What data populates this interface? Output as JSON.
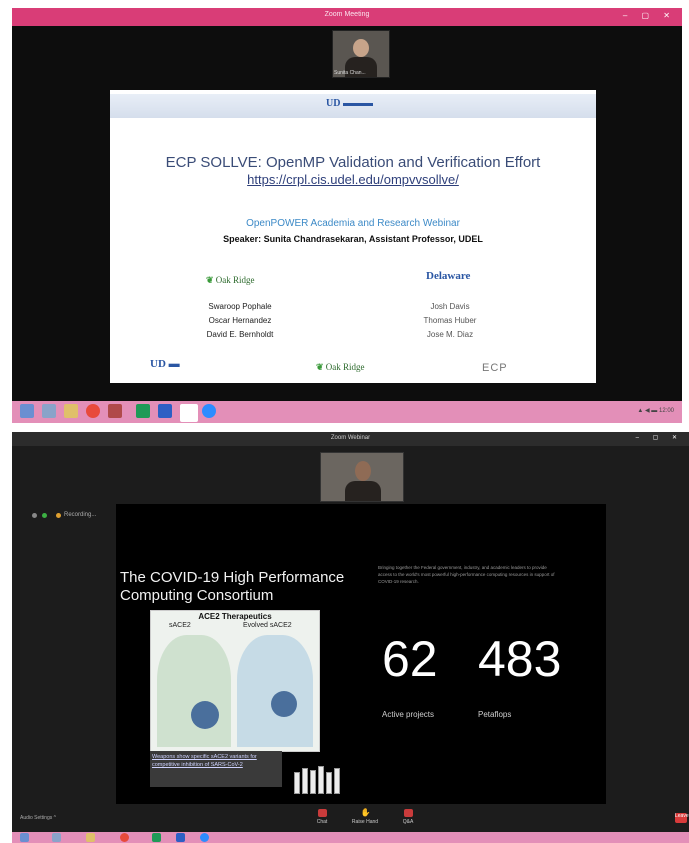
{
  "top_window": {
    "title": "Zoom Meeting",
    "participant_name": "Sunita Chan...",
    "slide": {
      "title": "ECP SOLLVE: OpenMP Validation and Verification Effort",
      "url": "https://crpl.cis.udel.edu/ompvvsollve/",
      "webinar": "OpenPOWER Academia and Research Webinar",
      "speaker": "Speaker: Sunita Chandrasekaran, Assistant Professor, UDEL",
      "ornl_label": "Oak Ridge",
      "ornl_names": [
        "Swaroop Pophale",
        "Oscar Hernandez",
        "David E. Bernholdt"
      ],
      "ud_label": "Delaware",
      "ud_names": [
        "Josh Davis",
        "Thomas Huber",
        "Jose M. Diaz"
      ],
      "ecp_label": "ECP"
    }
  },
  "bottom_window": {
    "title": "Zoom Webinar",
    "recording": "Recording...",
    "slide": {
      "title": "The COVID-19 High Performance Computing Consortium",
      "description": "Bringing together the Federal government, industry, and academic leaders to provide access to the world's most powerful high-performance computing resources in support of COVID-19 research.",
      "figure_title": "ACE2 Therapeutics",
      "figure_left": "sACE2",
      "figure_right": "Evolved sACE2",
      "caption": "Weapons show specific sACE2 variants for competitive inhibition of SARS-CoV-2",
      "stat1_value": "62",
      "stat1_label": "Active projects",
      "stat2_value": "483",
      "stat2_label": "Petaflops"
    },
    "controls": [
      "Chat",
      "Raise Hand",
      "Q&A"
    ],
    "audio_settings": "Audio Settings ^",
    "end": "Leave"
  },
  "colors": {
    "zoom_titlebar": "#d93d77",
    "taskbar": "#e38fb8",
    "stat_text": "#ffffff"
  }
}
